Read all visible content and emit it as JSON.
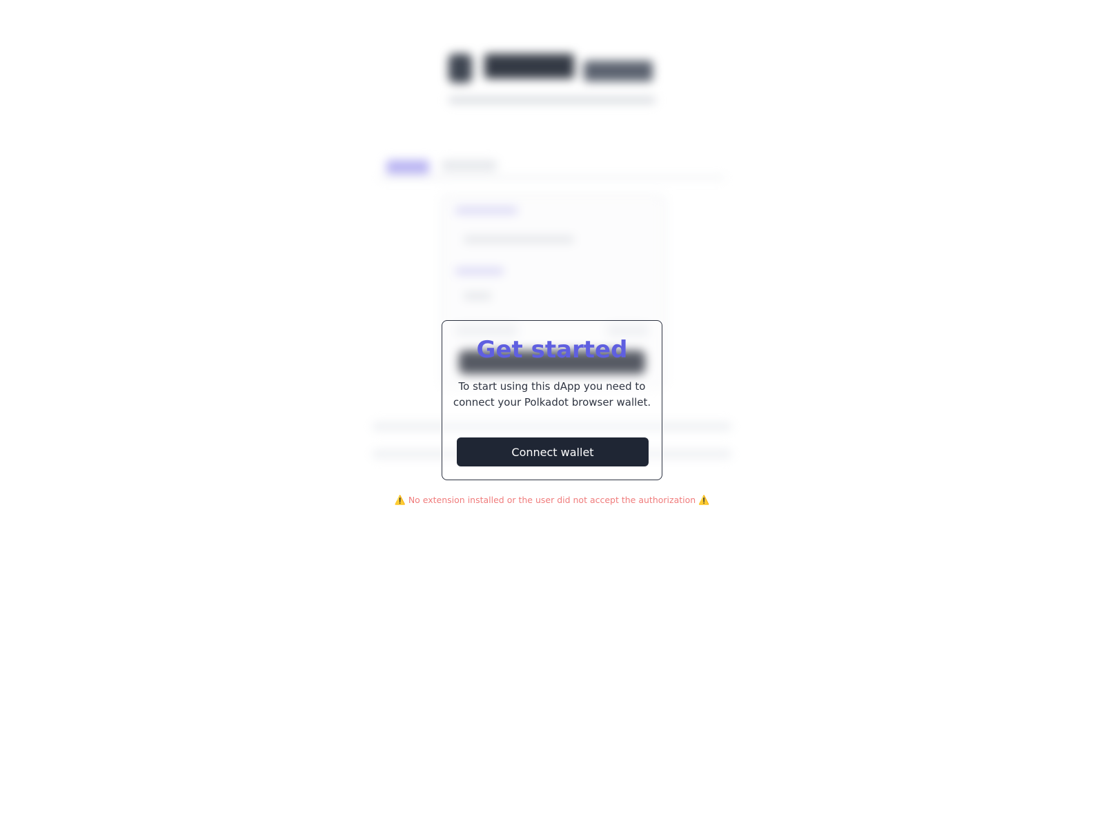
{
  "modal": {
    "title": "Get started",
    "description": "To start using this dApp you need to connect your Polkadot browser wallet.",
    "connect_button_label": "Connect wallet"
  },
  "warning": {
    "icon": "warning-icon",
    "icon_glyph": "⚠️",
    "text": "No extension installed or the user did not accept the authorization"
  },
  "colors": {
    "title_accent": "#5f5fe0",
    "button_bg": "#1f2634",
    "warning_text": "#f07c7c"
  }
}
